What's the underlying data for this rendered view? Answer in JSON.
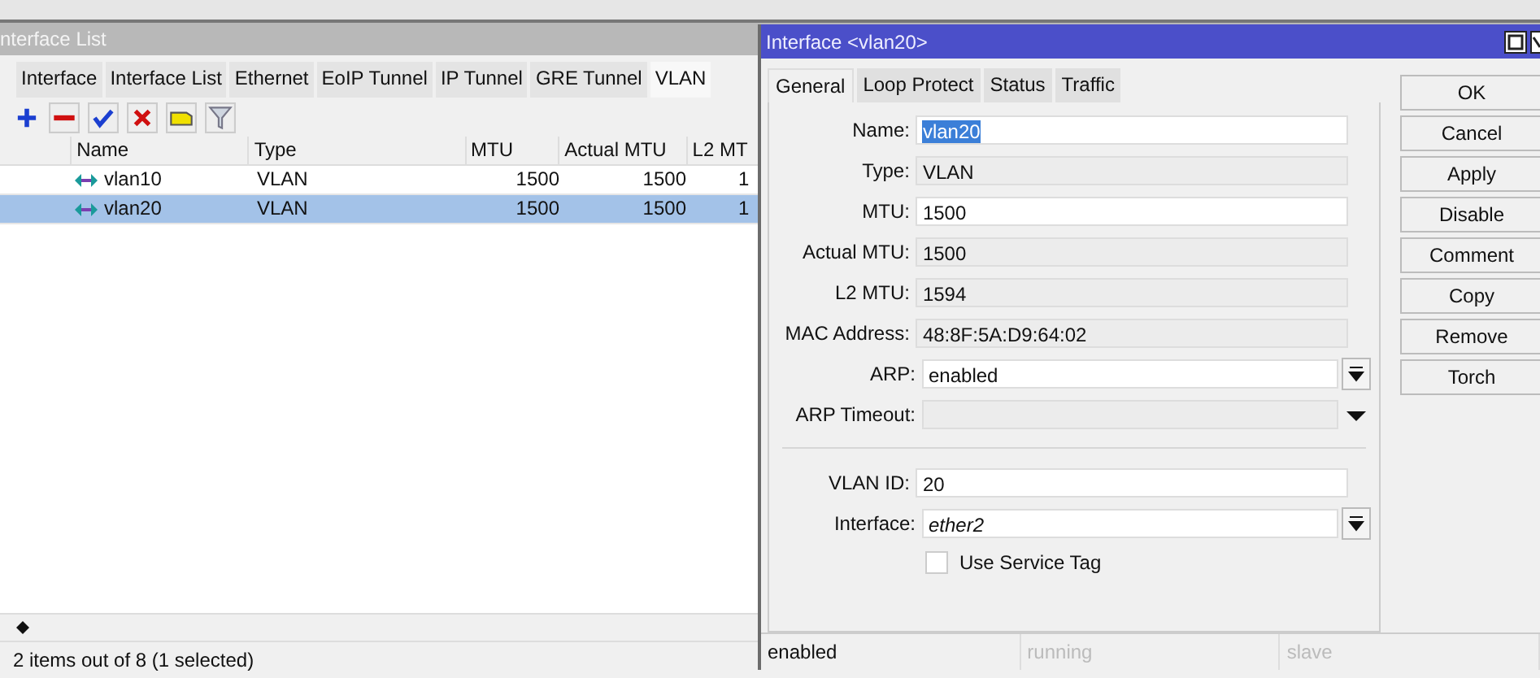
{
  "list_window": {
    "title": "nterface List",
    "tabs": [
      {
        "label": "Interface",
        "selected": false
      },
      {
        "label": "Interface List",
        "selected": false
      },
      {
        "label": "Ethernet",
        "selected": false
      },
      {
        "label": "EoIP Tunnel",
        "selected": false
      },
      {
        "label": "IP Tunnel",
        "selected": false
      },
      {
        "label": "GRE Tunnel",
        "selected": false
      },
      {
        "label": "VLAN",
        "selected": true
      }
    ],
    "columns": [
      "Name",
      "Type",
      "MTU",
      "Actual MTU",
      "L2 MT"
    ],
    "rows": [
      {
        "name": "vlan10",
        "type": "VLAN",
        "mtu": "1500",
        "actual_mtu": "1500",
        "l2_mtu": "1",
        "selected": false
      },
      {
        "name": "vlan20",
        "type": "VLAN",
        "mtu": "1500",
        "actual_mtu": "1500",
        "l2_mtu": "1",
        "selected": true
      }
    ],
    "status": "2 items out of 8 (1 selected)"
  },
  "dialog": {
    "title": "Interface <vlan20>",
    "tabs": [
      {
        "label": "General",
        "selected": true
      },
      {
        "label": "Loop Protect",
        "selected": false
      },
      {
        "label": "Status",
        "selected": false
      },
      {
        "label": "Traffic",
        "selected": false
      }
    ],
    "fields": [
      {
        "label": "Name:",
        "value": "vlan20",
        "kind": "text",
        "selected": true,
        "italic": false
      },
      {
        "label": "Type:",
        "value": "VLAN",
        "kind": "readonly",
        "selected": false,
        "italic": false
      },
      {
        "label": "MTU:",
        "value": "1500",
        "kind": "text",
        "selected": false,
        "italic": false
      },
      {
        "label": "Actual MTU:",
        "value": "1500",
        "kind": "readonly",
        "selected": false,
        "italic": false
      },
      {
        "label": "L2 MTU:",
        "value": "1594",
        "kind": "readonly",
        "selected": false,
        "italic": false
      },
      {
        "label": "MAC Address:",
        "value": "48:8F:5A:D9:64:02",
        "kind": "readonly",
        "selected": false,
        "italic": false
      },
      {
        "label": "ARP:",
        "value": "enabled",
        "kind": "dropdown",
        "selected": false,
        "italic": false
      },
      {
        "label": "ARP Timeout:",
        "kind": "optional"
      }
    ],
    "vlan_fields": [
      {
        "label": "VLAN ID:",
        "value": "20",
        "kind": "text",
        "selected": false,
        "italic": false
      },
      {
        "label": "Interface:",
        "value": "ether2",
        "kind": "dropdown",
        "selected": false,
        "italic": true
      }
    ],
    "checkbox": {
      "label": "Use Service Tag",
      "checked": false
    },
    "buttons": [
      "OK",
      "Cancel",
      "Apply",
      "Disable",
      "Comment",
      "Copy",
      "Remove",
      "Torch"
    ],
    "status": [
      {
        "text": "enabled",
        "active": true
      },
      {
        "text": "running",
        "active": false
      },
      {
        "text": "slave",
        "active": false
      }
    ]
  }
}
